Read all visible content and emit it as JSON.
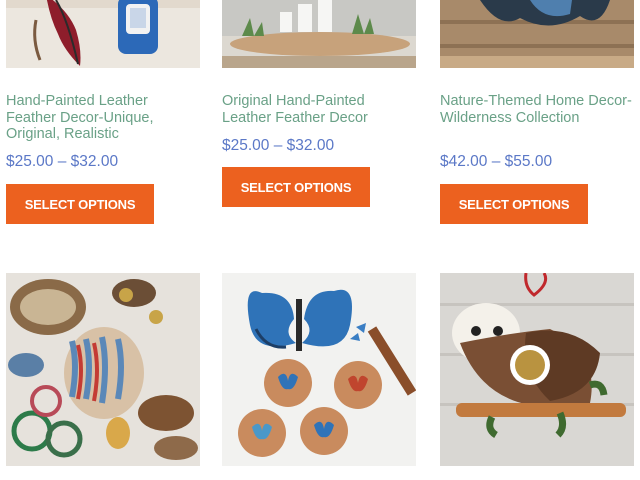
{
  "products": [
    {
      "title": "Hand-Painted Leather Feather Decor-Unique, Original, Realistic",
      "price_low": "$25.00",
      "price_sep": "–",
      "price_high": "$32.00",
      "button": "Select options",
      "image_icon": "feather-earrings-image"
    },
    {
      "title": "Original Hand-Painted Leather Feather Decor",
      "price_low": "$25.00",
      "price_sep": "–",
      "price_high": "$32.00",
      "button": "Select options",
      "image_icon": "table-centerpiece-image"
    },
    {
      "title": "Nature-Themed Home Decor- Wilderness Collection",
      "price_low": "$42.00",
      "price_sep": "–",
      "price_high": "$55.00",
      "button": "Select options",
      "image_icon": "wildlife-decor-image"
    },
    {
      "title": "",
      "image_icon": "leather-ornaments-collage-image"
    },
    {
      "title": "",
      "image_icon": "butterfly-coasters-image"
    },
    {
      "title": "",
      "image_icon": "owl-ornament-image"
    }
  ],
  "colors": {
    "title": "#6aa187",
    "price": "#5b78c7",
    "button": "#ec611f"
  }
}
